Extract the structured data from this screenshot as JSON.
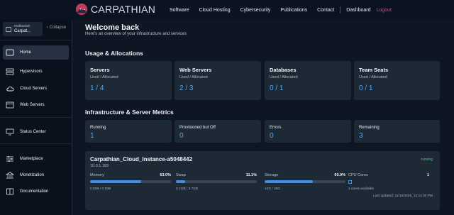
{
  "brand": {
    "name": "CARPATHIAN"
  },
  "nav": {
    "links": [
      "Software",
      "Cloud Hosting",
      "Cybersecurity",
      "Publications",
      "Contact"
    ],
    "dashboard": "Dashboard",
    "logout": "Logout"
  },
  "sidebar": {
    "account_user": "malkasian",
    "account_org": "Carpat...",
    "collapse": "Collapse",
    "items": [
      {
        "label": "Home",
        "icon": "home-icon"
      },
      {
        "label": "Hypervisors",
        "icon": "server-stack-icon"
      },
      {
        "label": "Cloud Servers",
        "icon": "cloud-icon"
      },
      {
        "label": "Web Servers",
        "icon": "browser-window-icon"
      },
      {
        "label": "Status Center",
        "icon": "monitor-icon"
      },
      {
        "label": "Marketplace",
        "icon": "sliders-icon"
      },
      {
        "label": "Monetization",
        "icon": "bank-icon"
      },
      {
        "label": "Documentation",
        "icon": "book-icon"
      }
    ]
  },
  "main": {
    "title": "Welcome back",
    "subtitle": "Here's an overview of your infrastructure and services",
    "usage_heading": "Usage & Allocations",
    "usage": [
      {
        "title": "Servers",
        "sub": "Used / Allocated",
        "value": "1 / 4"
      },
      {
        "title": "Web Servers",
        "sub": "Used / Allocated",
        "value": "2 / 3"
      },
      {
        "title": "Databases",
        "sub": "Used / Allocated",
        "value": "0 / 1"
      },
      {
        "title": "Team Seats",
        "sub": "Used / Allocated",
        "value": "0 / 1"
      }
    ],
    "metrics_heading": "Infrastructure & Server Metrics",
    "metrics": [
      {
        "title": "Running",
        "value": "1"
      },
      {
        "title": "Provisioned but Off",
        "value": "0"
      },
      {
        "title": "Errors",
        "value": "0"
      },
      {
        "title": "Remaining",
        "value": "3"
      }
    ],
    "instance": {
      "name": "Carpathian_Cloud_Instance-a5048442",
      "ip": "10.0.1.183",
      "status": "running",
      "resources": [
        {
          "label": "Memory",
          "percent_text": "63.0%",
          "fill_percent": 63.0,
          "detail": "0.60B / 0.90B"
        },
        {
          "label": "Swap",
          "percent_text": "11.1%",
          "fill_percent": 11.1,
          "detail": "0.4GB / 3.7GB"
        },
        {
          "label": "Storage",
          "percent_text": "60.0%",
          "fill_percent": 60.0,
          "detail": "12G / 20G"
        }
      ],
      "cpu": {
        "label": "CPU Cores",
        "value": "1",
        "detail": "1 cores available"
      },
      "last_updated": "Last updated: 11/16/2025, 12:14:30 PM"
    }
  },
  "colors": {
    "accent": "#53a7f0",
    "bar_fill": "#3f8fe8",
    "logout": "#e0457b",
    "running": "#43d08a"
  }
}
